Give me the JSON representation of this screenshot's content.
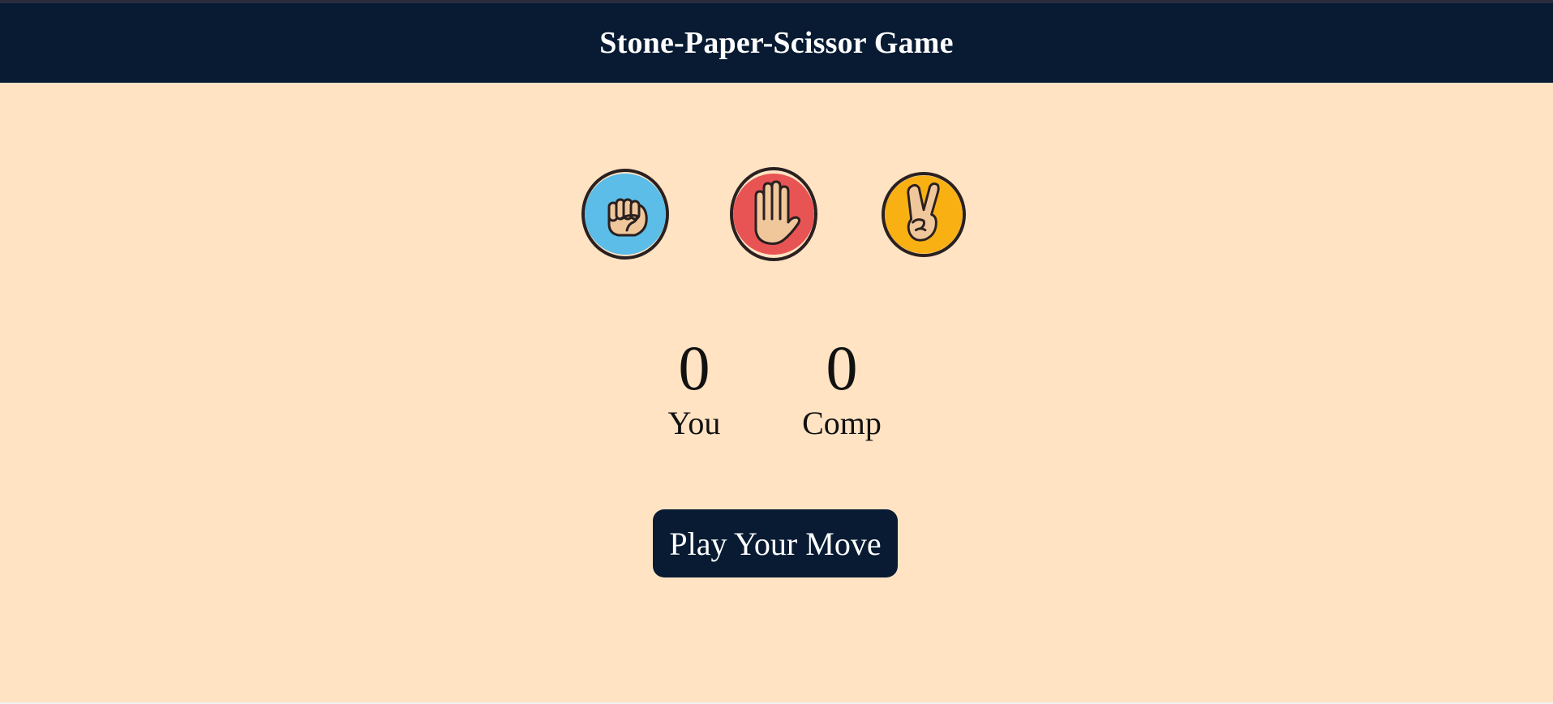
{
  "header": {
    "title": "Stone-Paper-Scissor Game"
  },
  "choices": [
    {
      "name": "stone",
      "icon": "fist-icon",
      "bg_color": "#5bbde8"
    },
    {
      "name": "paper",
      "icon": "open-hand-icon",
      "bg_color": "#e85454"
    },
    {
      "name": "scissor",
      "icon": "victory-hand-icon",
      "bg_color": "#f8b013"
    }
  ],
  "scoreboard": {
    "user": {
      "score": "0",
      "label": "You"
    },
    "comp": {
      "score": "0",
      "label": "Comp"
    }
  },
  "message": {
    "text": "Play Your Move"
  },
  "colors": {
    "header_bg": "#081b33",
    "page_bg": "#ffe3c3",
    "skin": "#f0c79b",
    "outline": "#2a2020"
  }
}
